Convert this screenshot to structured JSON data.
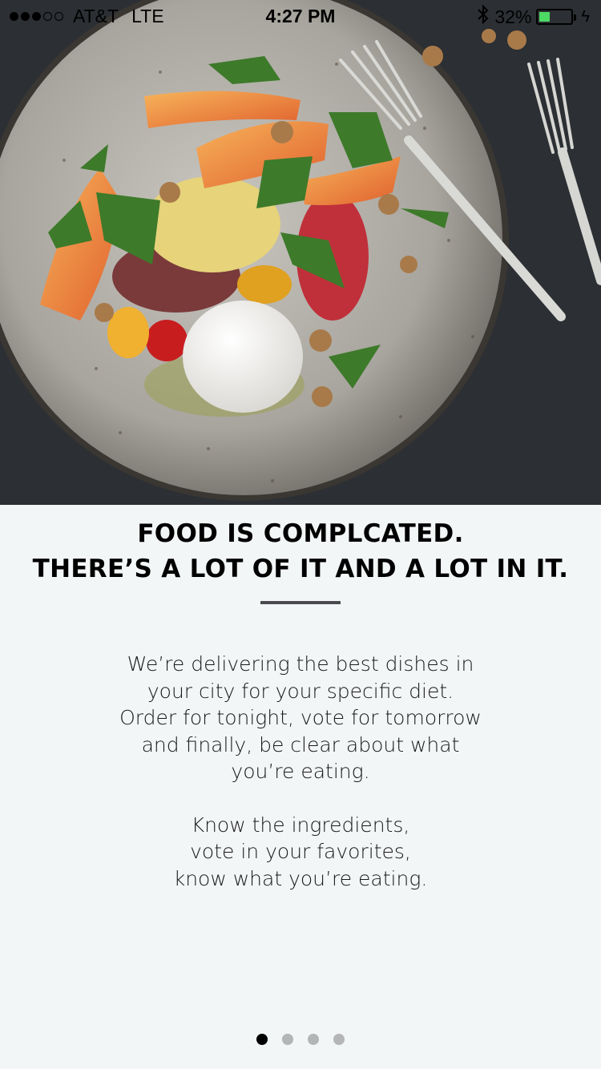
{
  "status_bar": {
    "signal_bars_filled": 3,
    "signal_bars_total": 5,
    "carrier": "AT&T",
    "network": "LTE",
    "time": "4:27 PM",
    "bluetooth_icon": "bluetooth-icon",
    "battery_percent_text": "32%",
    "battery_level": 0.32,
    "battery_color": "#4cd964"
  },
  "hero": {
    "image_icon": "food-plate-photo"
  },
  "headline": {
    "line1": "FOOD IS COMPLCATED.",
    "line2": "THERE’S A LOT OF IT AND A LOT IN IT."
  },
  "body": {
    "paragraph1": [
      "We’re delivering the best dishes in",
      "your city for your specific diet.",
      "Order for tonight, vote for tomorrow",
      "and finally, be clear about what",
      "you’re eating."
    ],
    "paragraph2": [
      "Know the ingredients,",
      "vote in your favorites,",
      "know what you’re eating."
    ]
  },
  "pager": {
    "total": 4,
    "active_index": 0
  }
}
